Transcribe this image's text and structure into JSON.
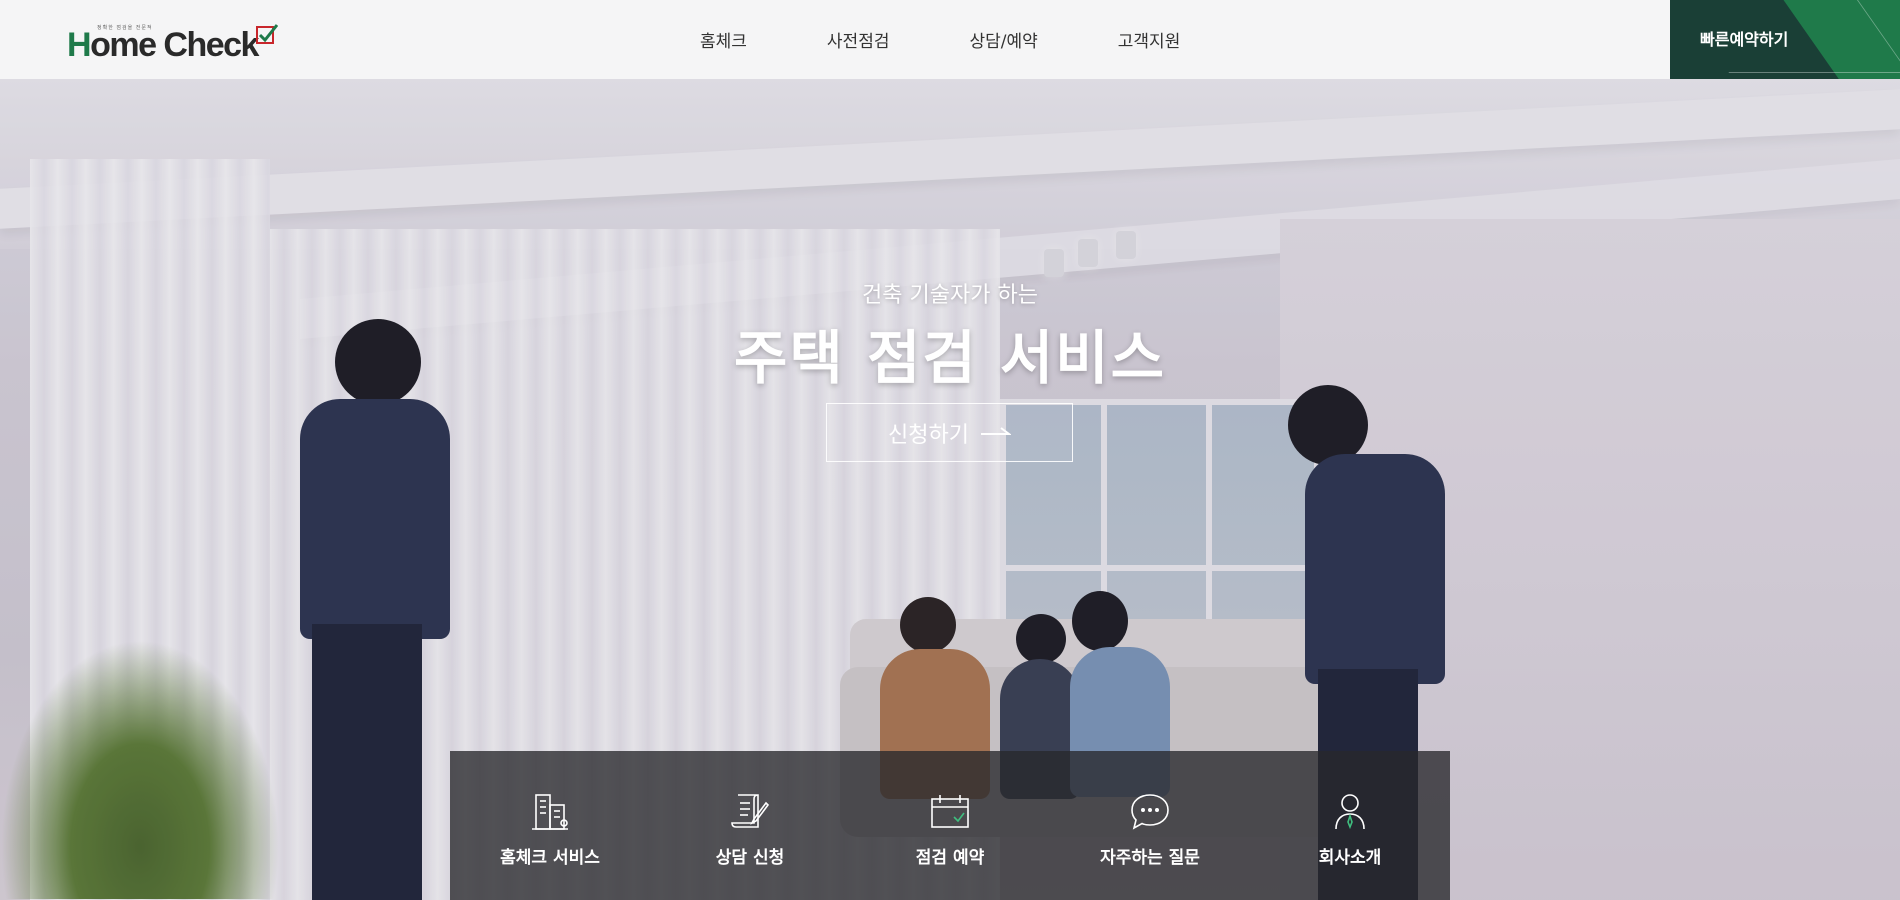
{
  "header": {
    "logo": {
      "tagline": "정확한 점검을 전문적",
      "word_h": "H",
      "word_rest": "ome Check"
    },
    "nav": [
      "홈체크",
      "사전점검",
      "상담/예약",
      "고객지원"
    ],
    "quick_booking_label": "빠른예약하기"
  },
  "hero": {
    "subtitle": "건축 기술자가 하는",
    "title": "주택 점검 서비스",
    "apply_button": "신청하기"
  },
  "quick_menu": [
    {
      "label": "홈체크 서비스",
      "icon": "building-icon"
    },
    {
      "label": "상담 신청",
      "icon": "document-pen-icon"
    },
    {
      "label": "점검 예약",
      "icon": "calendar-check-icon"
    },
    {
      "label": "자주하는 질문",
      "icon": "chat-bubble-icon"
    },
    {
      "label": "회사소개",
      "icon": "person-icon"
    }
  ],
  "colors": {
    "brand_green": "#1f7a4a",
    "brand_dark": "#1a3f36",
    "logo_red": "#c8262b"
  }
}
